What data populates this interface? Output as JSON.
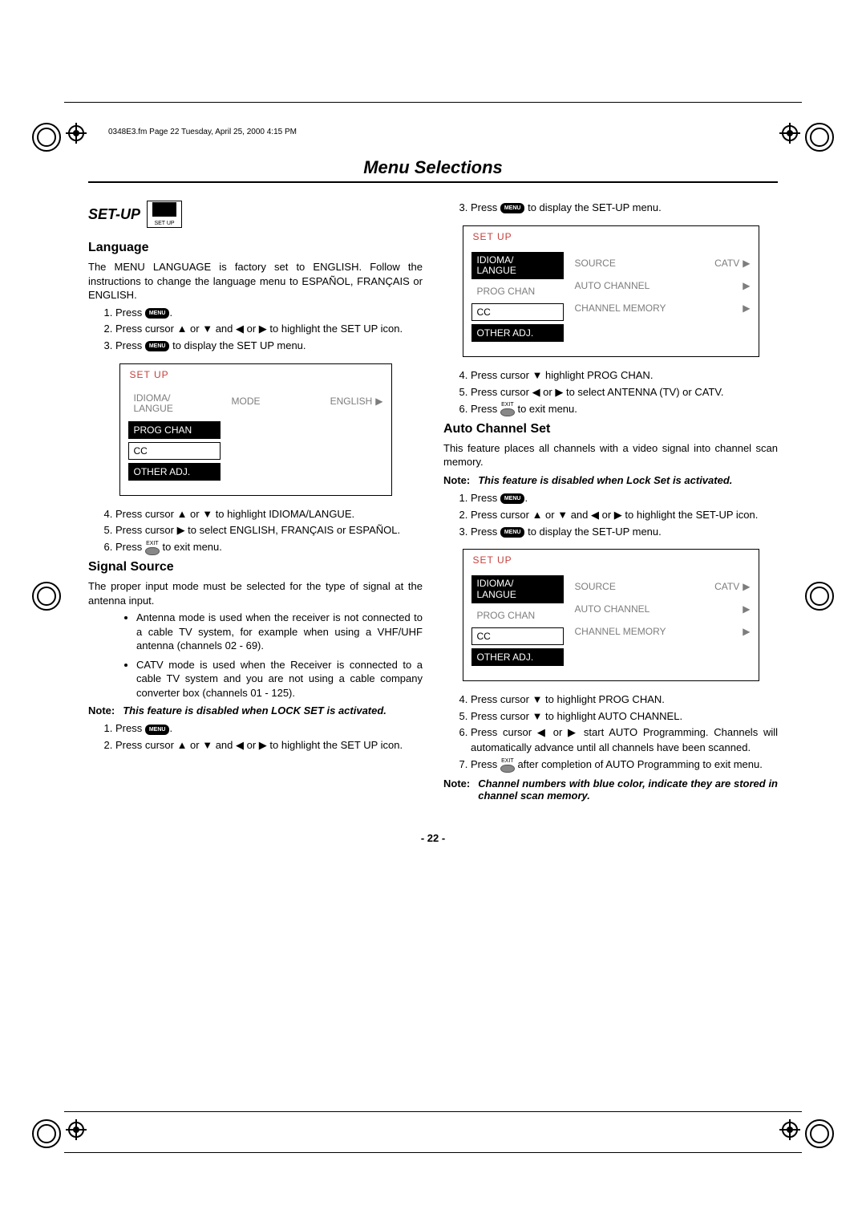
{
  "meta": {
    "header_line": "0348E3.fm  Page 22  Tuesday, April 25, 2000  4:15 PM"
  },
  "title": "Menu Selections",
  "set_up": {
    "label": "SET-UP",
    "icon_caption": "SET UP",
    "language": {
      "heading": "Language",
      "intro": "The MENU LANGUAGE is factory set to ENGLISH. Follow the instructions to change the language menu to ESPAÑOL, FRANÇAIS or ENGLISH.",
      "steps_a": {
        "s1_a": "Press ",
        "s1_b": ".",
        "s2": "Press cursor ▲ or ▼ and ◀ or ▶ to highlight the SET UP icon.",
        "s3_a": "Press ",
        "s3_b": " to display the SET UP menu."
      },
      "osd1": {
        "title": "SET UP",
        "tabs": {
          "idioma": "IDIOMA/\nLANGUE",
          "progchan": "PROG CHAN",
          "cc": "CC",
          "other": "OTHER ADJ."
        },
        "row1": {
          "label": "MODE",
          "value": "ENGLISH"
        }
      },
      "steps_b": {
        "s4": "Press cursor ▲ or ▼ to highlight IDIOMA/LANGUE.",
        "s5": "Press cursor ▶ to select ENGLISH, FRANÇAIS or ESPAÑOL.",
        "s6_a": "Press ",
        "s6_b": " to exit menu."
      }
    },
    "signal_source": {
      "heading": "Signal Source",
      "intro": "The proper input mode must be selected for the type of signal at the antenna input.",
      "bullets": {
        "b1": "Antenna mode is used when the receiver is not connected to a cable TV system, for example when using a VHF/UHF antenna (channels 02 - 69).",
        "b2": "CATV mode is used when the Receiver is connected to a cable TV system and you are not using a cable company converter box (channels 01 - 125)."
      },
      "note": {
        "label": "Note:",
        "body": "This feature is disabled when LOCK SET is activated."
      },
      "steps_a": {
        "s1_a": "Press ",
        "s1_b": ".",
        "s2": "Press cursor ▲ or ▼ and ◀ or ▶ to highlight the SET UP icon."
      },
      "steps_b": {
        "s3_a": "Press ",
        "s3_b": " to display the SET-UP menu."
      },
      "osd2": {
        "title": "SET UP",
        "tabs": {
          "idioma": "IDIOMA/\nLANGUE",
          "progchan": "PROG CHAN",
          "cc": "CC",
          "other": "OTHER ADJ."
        },
        "rows": {
          "r1": {
            "label": "SOURCE",
            "value": "CATV"
          },
          "r2": {
            "label": "AUTO CHANNEL",
            "value": ""
          },
          "r3": {
            "label": "CHANNEL MEMORY",
            "value": ""
          }
        }
      },
      "steps_c": {
        "s4": "Press cursor ▼ highlight PROG CHAN.",
        "s5": "Press cursor ◀ or ▶ to select ANTENNA (TV) or CATV.",
        "s6_a": "Press ",
        "s6_b": " to exit menu."
      }
    },
    "auto_channel": {
      "heading": "Auto Channel Set",
      "intro": "This feature places all channels with a video signal into channel scan memory.",
      "note1": {
        "label": "Note:",
        "body": "This feature is disabled when Lock Set is activated."
      },
      "steps_a": {
        "s1_a": "Press ",
        "s1_b": ".",
        "s2": "Press cursor ▲ or ▼ and ◀ or ▶ to highlight the SET-UP icon.",
        "s3_a": "Press ",
        "s3_b": " to display the SET-UP menu."
      },
      "osd3": {
        "title": "SET UP",
        "tabs": {
          "idioma": "IDIOMA/\nLANGUE",
          "progchan": "PROG CHAN",
          "cc": "CC",
          "other": "OTHER ADJ."
        },
        "rows": {
          "r1": {
            "label": "SOURCE",
            "value": "CATV"
          },
          "r2": {
            "label": "AUTO CHANNEL",
            "value": ""
          },
          "r3": {
            "label": "CHANNEL MEMORY",
            "value": ""
          }
        }
      },
      "steps_b": {
        "s4": "Press cursor ▼ to highlight PROG CHAN.",
        "s5": "Press cursor ▼ to highlight AUTO CHANNEL.",
        "s6": "Press cursor ◀ or ▶ start AUTO Programming. Channels will automatically advance until all channels have been scanned.",
        "s7_a": "Press ",
        "s7_b": " after completion of AUTO Programming to exit menu."
      },
      "note2": {
        "label": "Note:",
        "body": "Channel numbers with blue color, indicate they are stored in channel scan memory."
      }
    }
  },
  "keys": {
    "menu": "MENU",
    "exit": "EXIT"
  },
  "page_num": "- 22 -"
}
